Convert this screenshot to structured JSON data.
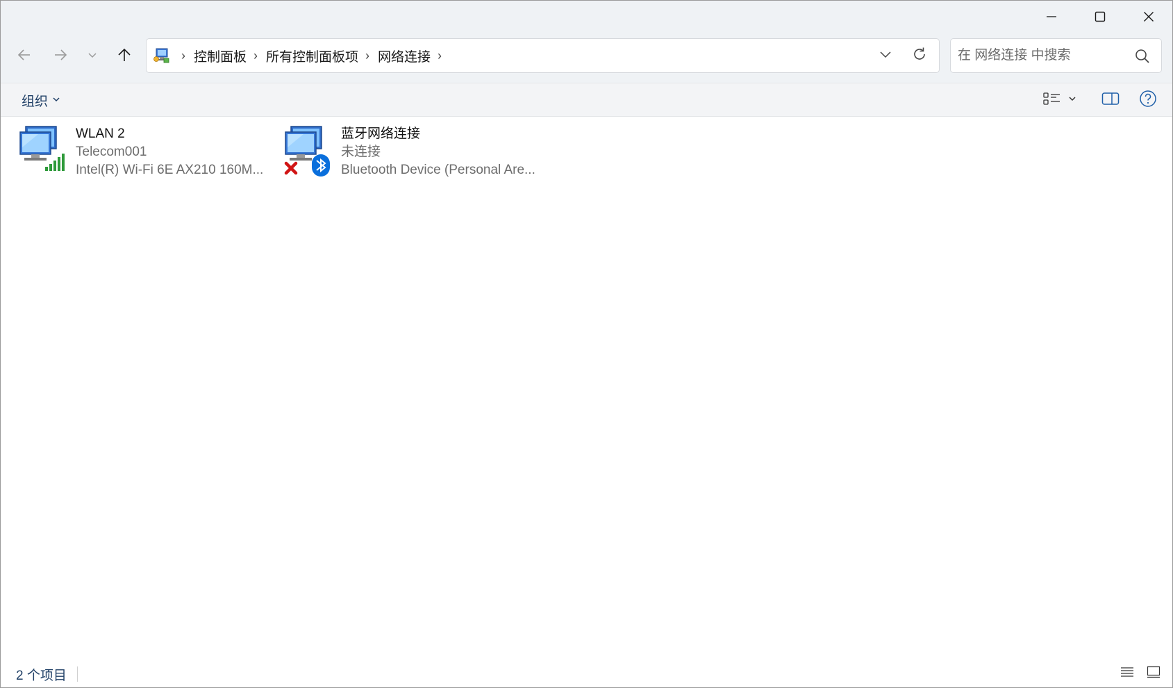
{
  "window": {
    "caption_buttons": [
      "minimize-icon",
      "maximize-icon",
      "close-icon"
    ]
  },
  "address": {
    "root_icon": "control-panel-icon",
    "breadcrumbs": [
      "控制面板",
      "所有控制面板项",
      "网络连接"
    ],
    "separator": "›"
  },
  "search": {
    "placeholder": "在 网络连接 中搜索"
  },
  "commandbar": {
    "organize_label": "组织"
  },
  "connections": [
    {
      "name": "WLAN 2",
      "status": "Telecom001",
      "device": "Intel(R) Wi-Fi 6E AX210 160M...",
      "icon": "network-computer-wifi-icon"
    },
    {
      "name": "蓝牙网络连接",
      "status": "未连接",
      "device": "Bluetooth Device (Personal Are...",
      "icon": "network-computer-bluetooth-icon"
    }
  ],
  "statusbar": {
    "item_count": "2 个项目"
  },
  "colors": {
    "chrome_bg": "#eff2f5",
    "accent_text": "#1f3f66",
    "wifi_green": "#2e9a3a",
    "bluetooth_blue": "#0a6fdc",
    "error_red": "#d11515"
  }
}
